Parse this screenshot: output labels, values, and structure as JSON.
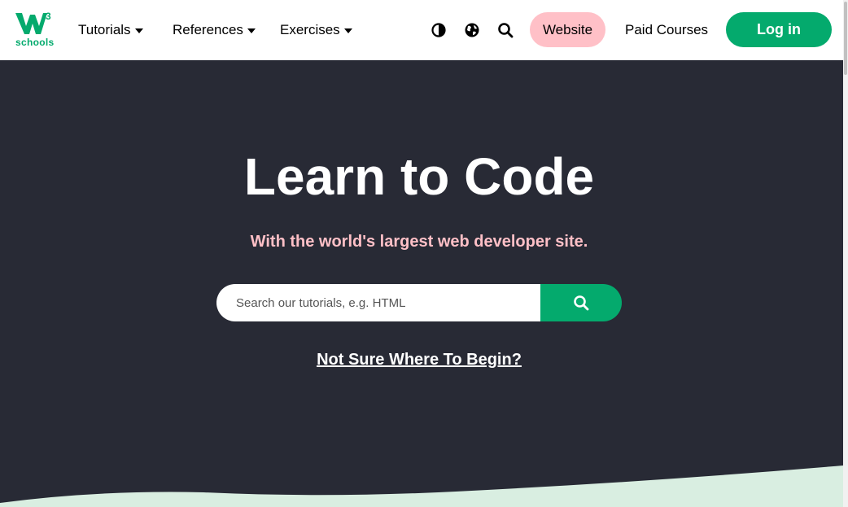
{
  "navbar": {
    "logo": {
      "mark": "W",
      "superscript": "3",
      "text": "schools"
    },
    "menus": [
      {
        "label": "Tutorials"
      },
      {
        "label": "References"
      },
      {
        "label": "Exercises"
      }
    ],
    "icons": [
      "contrast-icon",
      "globe-icon",
      "search-icon"
    ],
    "website_label": "Website",
    "paid_courses_label": "Paid Courses",
    "login_label": "Log in"
  },
  "hero": {
    "title": "Learn to Code",
    "subtitle": "With the world's largest web developer site.",
    "search": {
      "placeholder": "Search our tutorials, e.g. HTML",
      "value": ""
    },
    "not_sure_label": "Not Sure Where To Begin?"
  },
  "colors": {
    "brand_green": "#04aa6d",
    "hero_background": "#282a35",
    "accent_pink": "#ffc0c7",
    "wave_mint": "#d9eee1"
  }
}
